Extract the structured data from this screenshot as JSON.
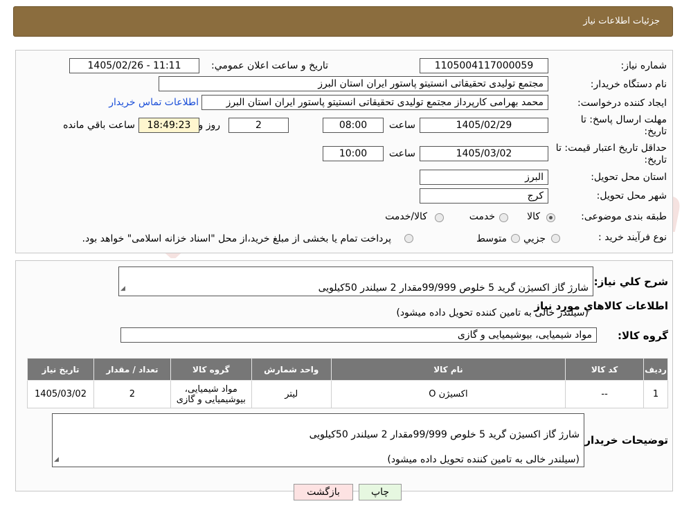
{
  "header": {
    "title": "جزئیات اطلاعات نیاز"
  },
  "form": {
    "need_number_label": "شماره نیاز:",
    "need_number": "1105004117000059",
    "announce_label": "تاریخ و ساعت اعلان عمومي:",
    "announce_value": "1405/02/26 - 11:11",
    "buyer_org_label": "نام دستگاه خریدار:",
    "buyer_org": "مجتمع تولیدی تحقیقاتی انستیتو پاستور ایران استان البرز",
    "creator_label": "ایجاد کننده درخواست:",
    "creator": "محمد بهرامی کارپرداز مجتمع تولیدی تحقیقاتی انستیتو پاستور ایران استان البرز",
    "contact_link": "اطلاعات تماس خریدار",
    "deadline_label": "مهلت ارسال پاسخ: تا تاریخ:",
    "deadline_date": "1405/02/29",
    "time_word": "ساعت",
    "deadline_time": "08:00",
    "days": "2",
    "days_and": "روز و",
    "remaining": "18:49:23",
    "remaining_label": "ساعت باقي مانده",
    "validity_label": "حداقل تاریخ اعتبار قیمت: تا تاریخ:",
    "validity_date": "1405/03/02",
    "validity_time": "10:00",
    "province_label": "استان محل تحویل:",
    "province": "البرز",
    "city_label": "شهر محل تحویل:",
    "city": "کرج",
    "category_label": "طبقه بندی موضوعی:",
    "category_options": [
      "کالا",
      "خدمت",
      "کالا/خدمت"
    ],
    "category_selected": "کالا",
    "process_label": "نوع فرآیند خرید :",
    "process_options": [
      "جزیي",
      "متوسط"
    ],
    "process_note": "پرداخت تمام یا بخشی از مبلغ خرید،از محل \"اسناد خزانه اسلامی\" خواهد بود."
  },
  "description": {
    "label": "شرح کلي نياز:",
    "line1": "شارژ گاز اکسیژن گرید 5 خلوص 99/999مقدار 2 سیلندر 50کیلویی",
    "line2": "(سیلندر خالی به تامین کننده  تحویل داده میشود)"
  },
  "goods_info_title": "اطلاعات کالاهاي مورد نياز",
  "goods_group": {
    "label": "گروه کالا:",
    "value": "مواد شیمیایی، بیوشیمیایی و  گازی"
  },
  "table": {
    "headers": [
      "رديف",
      "کد کالا",
      "نام کالا",
      "واحد شمارش",
      "گروه کالا",
      "تعداد / مقدار",
      "تاریخ نیاز"
    ],
    "rows": [
      {
        "row": "1",
        "code": "--",
        "name": "اکسیژن O",
        "unit": "لیتر",
        "group": "مواد شیمیایی، بیوشیمیایی و گازی",
        "qty": "2",
        "date": "1405/03/02"
      }
    ]
  },
  "buyer_notes": {
    "label": "توضیحات خریدار:",
    "line1": "شارژ گاز اکسیژن گرید 5 خلوص 99/999مقدار 2 سیلندر 50کیلویی",
    "line2": "(سیلندر خالی به تامین کننده  تحویل داده میشود)"
  },
  "buttons": {
    "print": "چاپ",
    "back": "بازگشت"
  },
  "watermark": {
    "text": "AriaTender.neT"
  },
  "colors": {
    "header_bg": "#8b6d3e",
    "table_header": "#777777",
    "link": "#1a4ed8",
    "print_btn": "#e6f7e0",
    "back_btn": "#fde2e2"
  }
}
